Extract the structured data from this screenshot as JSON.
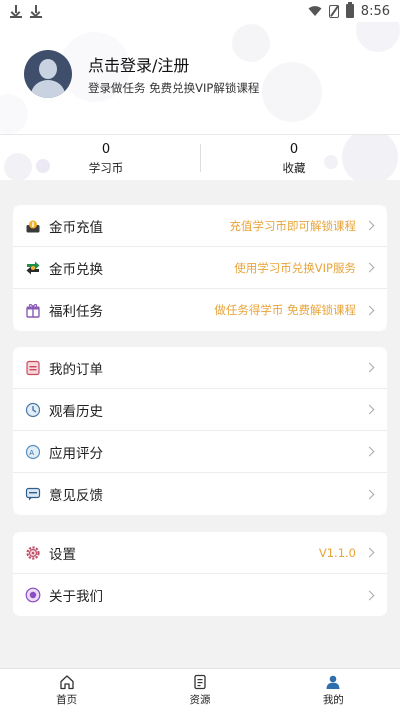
{
  "status_bar": {
    "time": "8:56"
  },
  "profile": {
    "title": "点击登录/注册",
    "subtitle": "登录做任务 免费兑换VIP解锁课程"
  },
  "stats": [
    {
      "value": "0",
      "label": "学习币"
    },
    {
      "value": "0",
      "label": "收藏"
    }
  ],
  "card1": [
    {
      "icon": "coin-recharge-icon",
      "label": "金币充值",
      "hint": "充值学习币即可解锁课程"
    },
    {
      "icon": "coin-exchange-icon",
      "label": "金币兑换",
      "hint": "使用学习币兑换VIP服务"
    },
    {
      "icon": "gift-icon",
      "label": "福利任务",
      "hint": "做任务得学币 免费解锁课程"
    }
  ],
  "card2": [
    {
      "icon": "orders-icon",
      "label": "我的订单"
    },
    {
      "icon": "history-icon",
      "label": "观看历史"
    },
    {
      "icon": "rating-icon",
      "label": "应用评分"
    },
    {
      "icon": "feedback-icon",
      "label": "意见反馈"
    }
  ],
  "card3": [
    {
      "icon": "settings-icon",
      "label": "设置",
      "hint": "V1.1.0"
    },
    {
      "icon": "about-icon",
      "label": "关于我们"
    }
  ],
  "tabs": [
    {
      "icon": "home-icon",
      "label": "首页"
    },
    {
      "icon": "resources-icon",
      "label": "资源"
    },
    {
      "icon": "profile-icon",
      "label": "我的"
    }
  ],
  "colors": {
    "accent": "#e8a43a",
    "tab_active": "#2f6fae"
  }
}
